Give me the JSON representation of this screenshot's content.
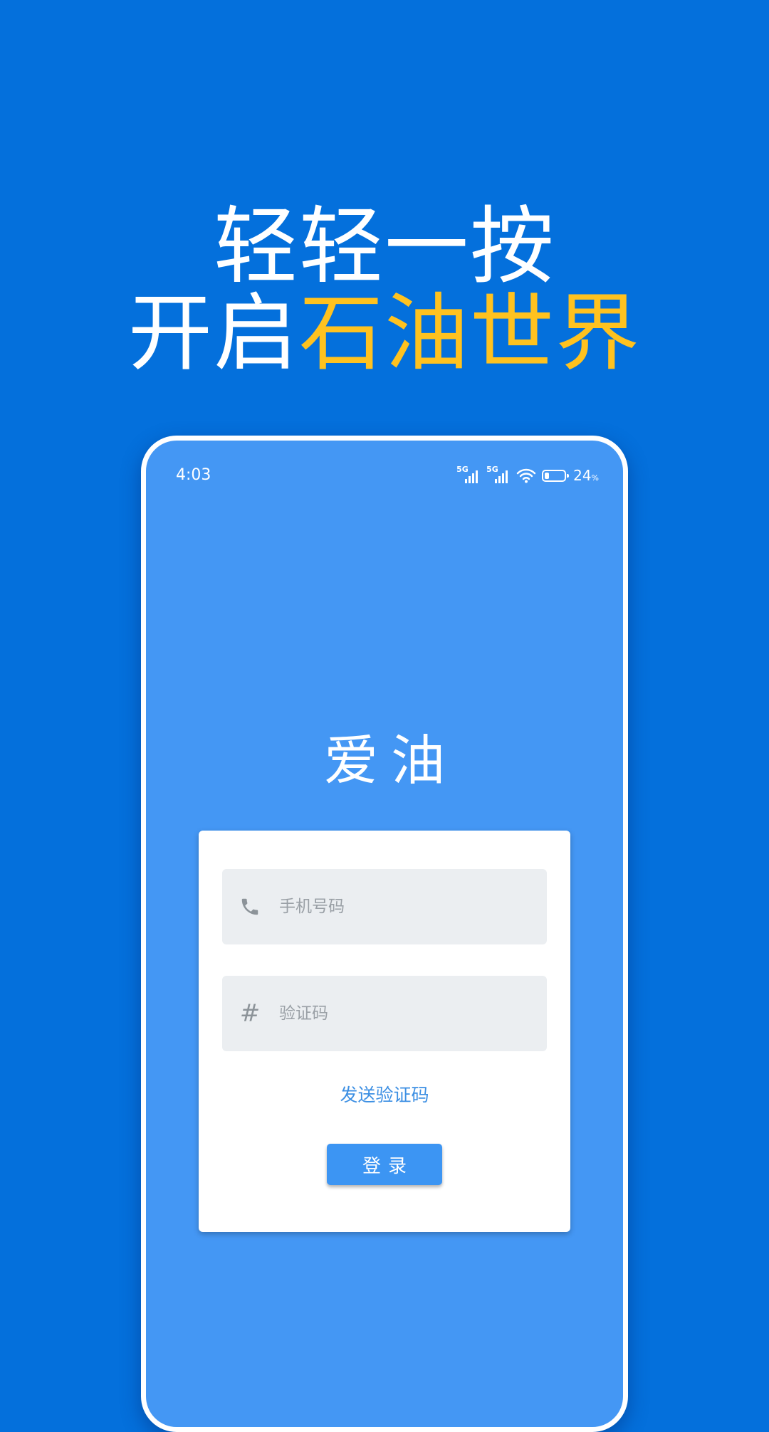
{
  "promo": {
    "line1": "轻轻一按",
    "line2_prefix": "开启",
    "line2_highlight": "石油世界",
    "highlight_color": "#FFC21F"
  },
  "status_bar": {
    "time": "4:03",
    "network_labels": [
      "5G",
      "5G"
    ],
    "wifi_icon": "wifi-icon",
    "battery_value": "24",
    "battery_unit": "%",
    "battery_level": 0.24
  },
  "app": {
    "title": "爱油"
  },
  "login_form": {
    "phone_icon": "phone-icon",
    "phone_placeholder": "手机号码",
    "code_icon_glyph": "#",
    "code_placeholder": "验证码",
    "send_code_label": "发送验证码",
    "login_label": "登录"
  },
  "colors": {
    "background": "#0470DC",
    "phone_screen": "#4497F4",
    "accent_blue": "#3C95F3",
    "field_background": "#EBEEF1"
  }
}
